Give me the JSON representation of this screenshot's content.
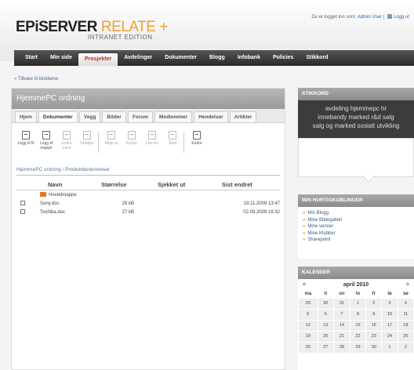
{
  "header": {
    "logo_main": "EPiSERVER",
    "logo_accent": "RELATE +",
    "logo_sub": "INTRANET EDITION",
    "user_prefix": "Du er logget inn som:",
    "user_name": "Admin User",
    "logout": "Logg ut",
    "back_link": "Tilbake til klubbene"
  },
  "nav": [
    "Start",
    "Min side",
    "Prosjekter",
    "Avdelinger",
    "Dokumenter",
    "Blogg",
    "Infobank",
    "Policies",
    "Stikkord"
  ],
  "club": {
    "title": "HjemmePC ordning",
    "tabs": [
      "Hjem",
      "Dokumenter",
      "Vegg",
      "Bilder",
      "Forum",
      "Medlemmer",
      "Hendelser",
      "Artikler"
    ],
    "active_tab": "Dokumenter"
  },
  "toolbar": [
    {
      "label": "Legg til fil",
      "enabled": true
    },
    {
      "label": "Legg til mappe",
      "enabled": true
    },
    {
      "label": "Endre navn",
      "enabled": false
    },
    {
      "label": "Detaljer",
      "enabled": false
    },
    {
      "label": "Klipp ut",
      "enabled": false
    },
    {
      "label": "Kopier",
      "enabled": false
    },
    {
      "label": "Lim inn",
      "enabled": false
    },
    {
      "label": "Slett",
      "enabled": false
    },
    {
      "label": "Endre",
      "enabled": true
    }
  ],
  "breadcrumb": "HjemmePC ordning / Produktbeskrivelser",
  "files": {
    "headers": [
      "Navn",
      "Størrelse",
      "Sjekket ut",
      "Sist endret"
    ],
    "parent": "Hovedmappe",
    "rows": [
      {
        "name": "Sony.doc",
        "size": "28 kB",
        "checked_out": "",
        "modified": "19.11.2009 13:47"
      },
      {
        "name": "Toshiba.doc",
        "size": "27 kB",
        "checked_out": "",
        "modified": "02.09.2009 16:32"
      }
    ]
  },
  "stikkord": {
    "title": "STIKKORD",
    "lines": [
      "avdeling hjemmepc hr",
      "innebandy marked r&d salg",
      "salg og marked sosialt utvikling"
    ]
  },
  "quicklinks": {
    "title": "MIN HURTIGKOBLINGER",
    "items": [
      "Min Blogg",
      "Mine Bildegalleri",
      "Mine venner",
      "Mine Klubber",
      "Sharepoint"
    ]
  },
  "calendar": {
    "title": "KALENDER",
    "month": "april 2010",
    "prev": "<",
    "next": ">",
    "weekdays": [
      "ma",
      "ti",
      "on",
      "to",
      "fr",
      "lø",
      "sø"
    ],
    "weeks": [
      [
        "29",
        "30",
        "31",
        "1",
        "2",
        "3",
        "4"
      ],
      [
        "5",
        "6",
        "7",
        "8",
        "9",
        "10",
        "11"
      ],
      [
        "12",
        "13",
        "14",
        "15",
        "16",
        "17",
        "18"
      ],
      [
        "19",
        "20",
        "21",
        "22",
        "23",
        "24",
        "25"
      ],
      [
        "26",
        "27",
        "28",
        "29",
        "30",
        "1",
        "2"
      ]
    ]
  }
}
